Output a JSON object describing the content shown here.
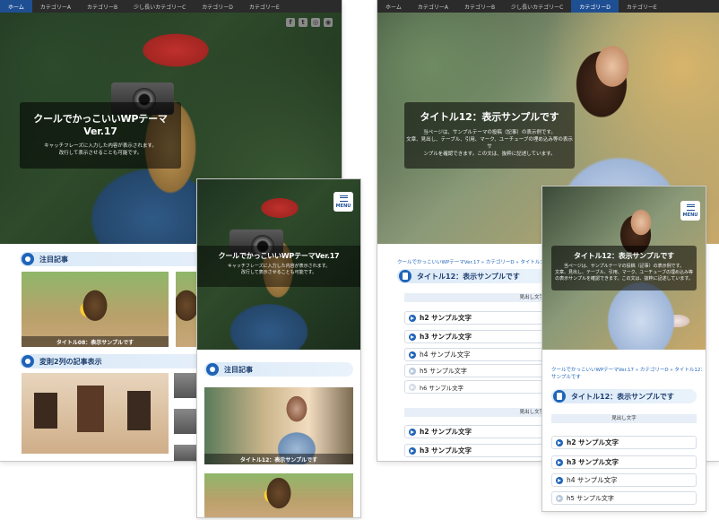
{
  "nav": {
    "items": [
      "ホーム",
      "カテゴリーA",
      "カテゴリーB",
      "少し長いカテゴリーC",
      "カテゴリーD",
      "カテゴリーE"
    ]
  },
  "social": {
    "icons": [
      "facebook-icon",
      "twitter-icon",
      "instagram-icon",
      "rss-icon"
    ],
    "glyphs": [
      "f",
      "t",
      "◎",
      "◉"
    ]
  },
  "menu": {
    "label": "MENU"
  },
  "site": {
    "title": "クールでかっこいいWPテーマVer.17",
    "catch_line1": "キャッチフレーズに入力した内容が表示されます。",
    "catch_line2": "改行して表示させることも可能です。"
  },
  "post": {
    "title": "タイトル12：表示サンプルです",
    "desc_line1": "当ページは、サンプルテーマの投稿（記事）の表示例です。",
    "desc_line2": "文章、見出し、テーブル、引用、マーク、ユーチューブの埋め込み等の表示サ",
    "desc_line3": "ンプルを確認できます。この文は、抜粋に記述しています。",
    "mobile_desc_line1": "当ページは、サンプルテーマの投稿（記事）の表示例です。",
    "mobile_desc_line2": "文章、見出し、テーブル、引用、マーク、ユーチューブの埋め込み等",
    "mobile_desc_line3": "の表示サンプルを確認できます。この文は、抜粋に記述しています。"
  },
  "sections": {
    "featured": "注目記事",
    "two_col": "変則2列の記事表示"
  },
  "cards": {
    "owl_caption": "タイトル08：表示サンプルです",
    "girl_caption": "タイトル12：表示サンプルです"
  },
  "breadcrumb": {
    "desktop": "クールでかっこいいWPテーマVer.17 » カテゴリーD » タイトル12：表示サンプルです",
    "mobile_line1": "クールでかっこいいWPテーマVer.17 » カテゴリーD » タイトル12：表示",
    "mobile_line2": "サンプルです"
  },
  "midashi": {
    "label": "見出し文字"
  },
  "headings": {
    "h2": "h2 サンプル文字",
    "h3": "h3 サンプル文字",
    "h4": "h4 サンプル文字",
    "h5": "h5 サンプル文字",
    "h6": "h6 サンプル文字"
  },
  "colors": {
    "accent": "#1f64b8",
    "nav_bg": "#2b2b2b",
    "nav_active": "#1f4f93",
    "section_bg": "#dbe9f7"
  }
}
